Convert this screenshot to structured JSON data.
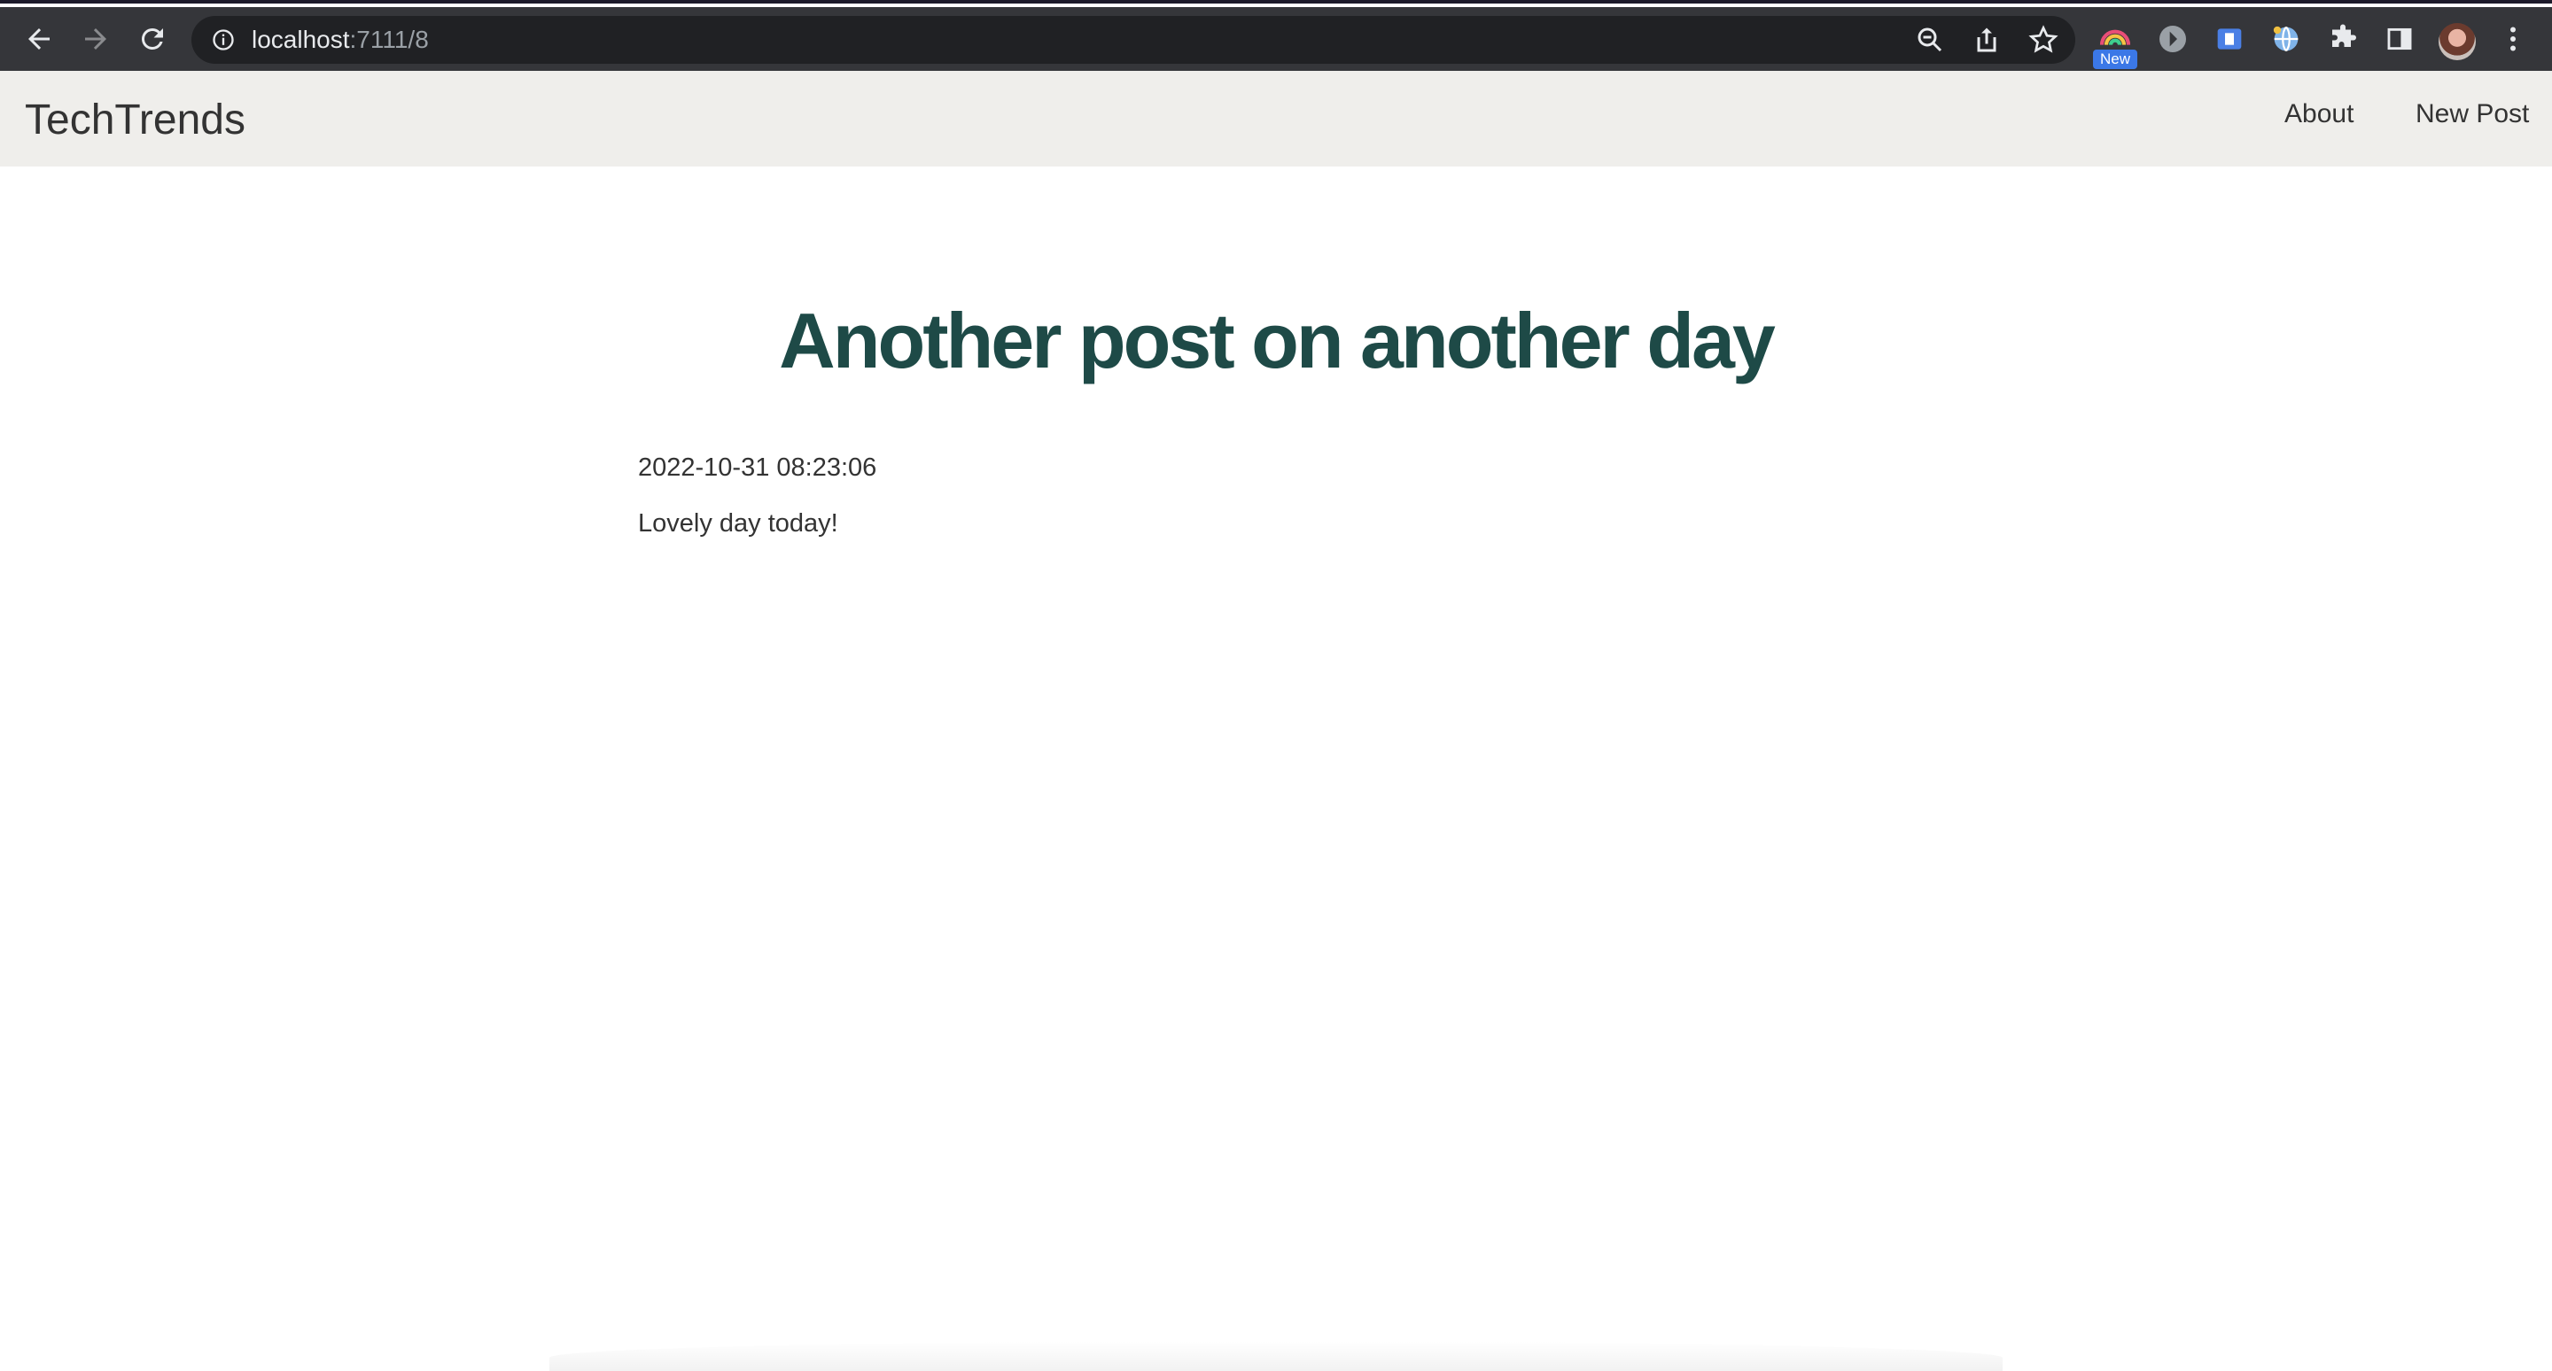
{
  "browser": {
    "url_host": "localhost",
    "url_path": ":7111/8",
    "extension_badge": "New"
  },
  "site": {
    "brand": "TechTrends",
    "nav": {
      "about": "About",
      "new_post": "New Post"
    }
  },
  "post": {
    "title": "Another post on another day",
    "created": "2022-10-31 08:23:06",
    "content": "Lovely day today!"
  },
  "colors": {
    "title": "#1e4a47",
    "navbar_bg": "#efeeeb",
    "toolbar_bg": "#35363a"
  }
}
